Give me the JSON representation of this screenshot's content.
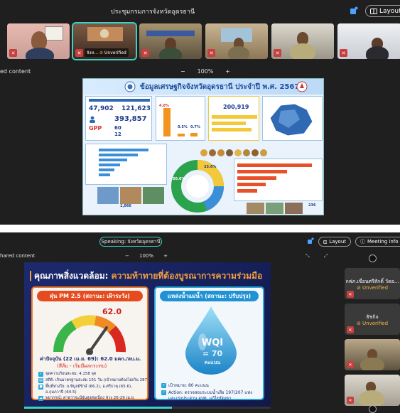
{
  "panel1": {
    "meeting_title": "ประชุมกรมการจังหวัดอุดรธานี",
    "layout_label": "Layout",
    "shared_label": "ed content",
    "zoom": {
      "minus": "−",
      "level": "100%",
      "plus": "+"
    },
    "participants": [
      {
        "label": ""
      },
      {
        "label": "จังห...",
        "status": "Unverified",
        "active": true
      },
      {
        "label": ""
      },
      {
        "label": ""
      },
      {
        "label": ""
      },
      {
        "label": ""
      }
    ],
    "slide": {
      "title": "ข้อมูลเศรษฐกิจจังหวัดอุดรธานี ประจำปี พ.ศ. 2567",
      "num_a": "47,902",
      "num_b": "121,623",
      "num_c": "393,857",
      "num_d": "200,919",
      "gpp_label": "GPP",
      "rank_1": "60",
      "rank_2": "12",
      "pct_1": "4.0%",
      "pct_2": "0.5%",
      "pct_3": "0.7%",
      "pct_center_1": "33.6%",
      "pct_center_2": "50.6%",
      "num_e": "1,066",
      "num_f": "236"
    }
  },
  "panel2": {
    "speaking_label": "Speaking: จังหวัดอุดรธานี",
    "layout_label": "Layout",
    "meeting_info_label": "Meeting info",
    "shared_label": "hared content",
    "zoom": {
      "minus": "−",
      "level": "100%",
      "plus": "+"
    },
    "slide": {
      "title_white": "คุณภาพสิ่งแวดล้อม:",
      "title_orange": "ความท้าทายที่ต้องบูรณาการความร่วมมือ",
      "left_card": {
        "header": "ฝุ่น PM 2.5 (สถานะ: เฝ้าระวัง)",
        "value": "62.0",
        "current": "ค่าปัจจุบัน (22 เม.ย. 69): 62.0 มคก./ลบ.ม.",
        "level": "(สีส้ม - เริ่มมีผลกระทบ)",
        "items": [
          "จุดความร้อนสะสม: 4,158 จุด",
          "สถิติ: เกินมาตรฐานสะสม 151 วัน (เป้าหมายต้องไม่เกิน 287 วัน)",
          "พื้นที่ห่วงใย: อ.พิบูลย์รักษ์ (66.2), อ.ศรีธาตุ (65.6),",
          "อ.กุมภวาปี (64.5)",
          "พยากรณ์: คาดว่าจะมีฝุ่นสูงต่อเนื่อง ช่วง 26-29 เม.ย."
        ]
      },
      "right_card": {
        "header": "แหล่งน้ำแม่น้ำ (สถานะ: ปรับปรุง)",
        "wqi_label": "WQI",
        "wqi_value": "= 70",
        "wqi_unit": "คะแนน",
        "items": [
          "เป้าหมาย: 80 คะแนน",
          "Action: ตรวจสอบระบบน้ำเสีย 197/207 แห่ง",
          "และเร่งประสาน อปท. แก้ไขปัญหา"
        ]
      }
    },
    "sidebar": [
      {
        "name": "กฟภ.เขื่อนศรีสักดิ์ วัดอ...",
        "status": "Unverified"
      },
      {
        "name": "ธัชกิจ",
        "status": "Unverified"
      },
      {
        "name": ""
      },
      {
        "name": ""
      }
    ]
  }
}
